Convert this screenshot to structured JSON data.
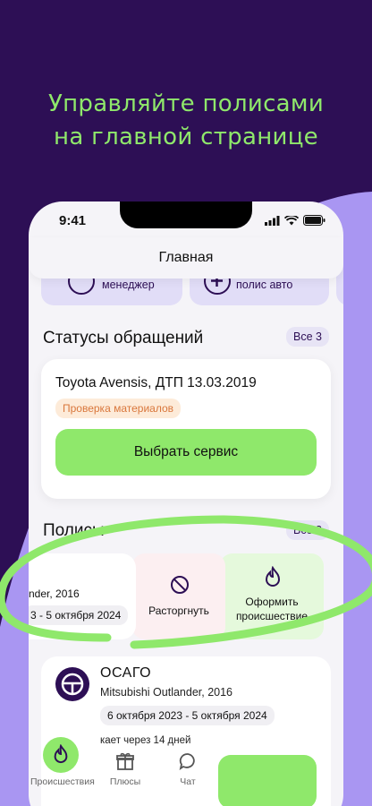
{
  "hero": {
    "line1": "Управляйте полисами",
    "line2": "на главной странице"
  },
  "status_bar": {
    "time": "9:41"
  },
  "header": {
    "title": "Главная"
  },
  "quick_actions": [
    {
      "label": "менеджер",
      "icon": "phone-icon"
    },
    {
      "label": "полис авто",
      "icon": "plus-icon"
    }
  ],
  "requests": {
    "title": "Статусы обращений",
    "all_label": "Все 3",
    "card": {
      "title": "Toyota Avensis, ДТП 13.03.2019",
      "status_tag": "Проверка материалов",
      "button": "Выбрать сервис"
    }
  },
  "policies": {
    "title": "Полисы",
    "all_label": "Все 3",
    "swiped_card": {
      "car_partial": "nder, 2016",
      "dates_partial": "3 - 5 октября 2024"
    },
    "actions": {
      "cancel": "Расторгнуть",
      "incident_line1": "Оформить",
      "incident_line2": "происшествие"
    },
    "card2": {
      "title": "ОСАГО",
      "car": "Mitsubishi Outlander, 2016",
      "dates": "6 октября 2023 - 5 октября 2024",
      "expire_partial": "кает через 14 дней"
    }
  },
  "tabbar": {
    "items": [
      {
        "label": "Происшествия",
        "icon": "flame-icon"
      },
      {
        "label": "Плюсы",
        "icon": "gift-icon"
      },
      {
        "label": "Чат",
        "icon": "chat-icon"
      }
    ]
  },
  "colors": {
    "brand_purple": "#2D0F55",
    "accent_green": "#8FE86B",
    "lavender": "#A996F2"
  }
}
